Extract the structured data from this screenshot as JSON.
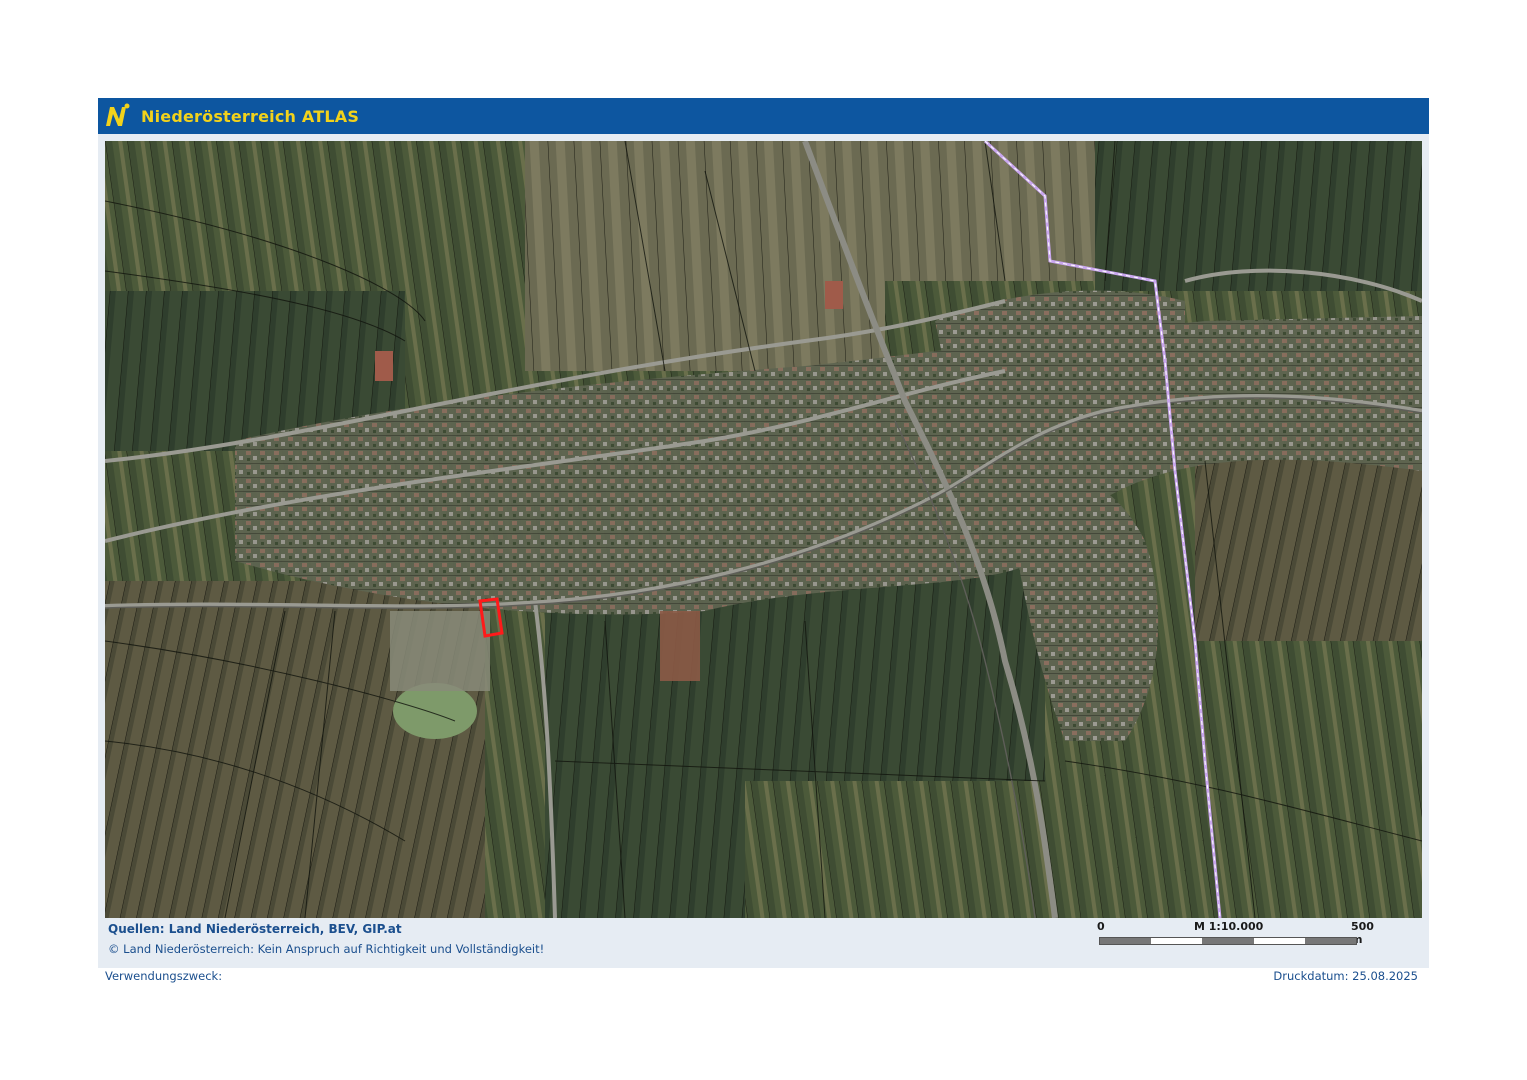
{
  "header": {
    "title": "Niederösterreich ATLAS",
    "logo_icon": "noe-logo-icon",
    "color_bar": "#0d56a0",
    "color_title": "#f2d21b"
  },
  "map": {
    "type": "aerial-orthophoto-with-cadastral-parcels",
    "highlighted_parcel_color": "#ff1a1a",
    "boundary_color": "#c9a6ee"
  },
  "footer": {
    "sources": "Quellen: Land Niederösterreich, BEV, GIP.at",
    "copyright": "© Land Niederösterreich: Kein Anspruch auf Richtigkeit und Vollständigkeit!",
    "purpose_label": "Verwendungszweck:",
    "print_date": "Druckdatum: 25.08.2025"
  },
  "scalebar": {
    "start": "0",
    "ratio": "M 1:10.000",
    "end": "500 m"
  }
}
